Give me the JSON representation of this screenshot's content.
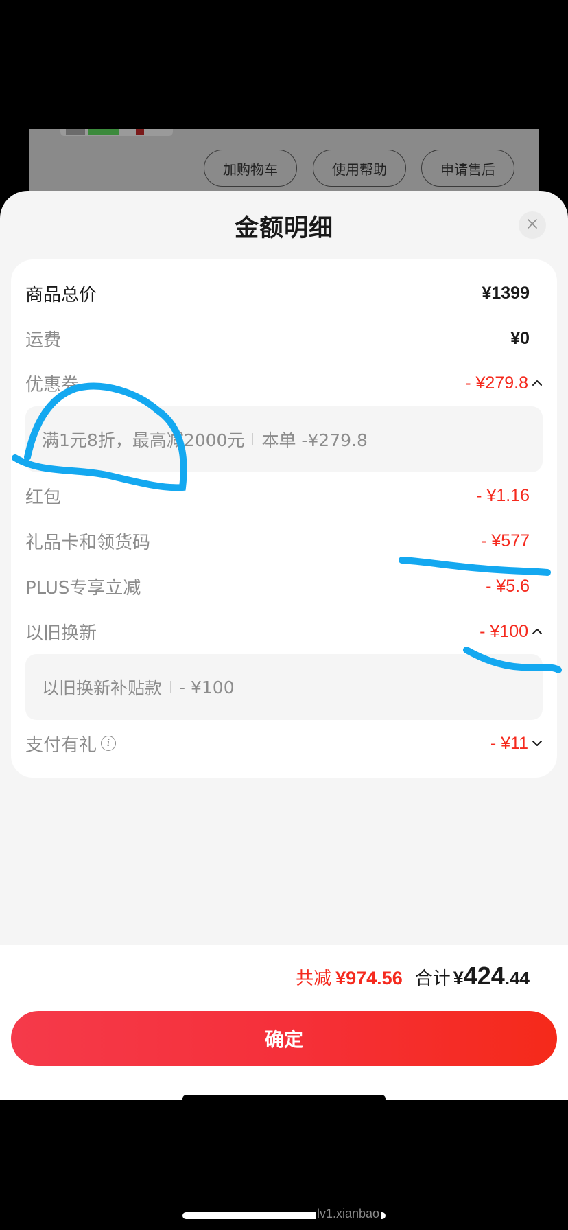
{
  "background_page": {
    "buttons": [
      "加购物车",
      "使用帮助",
      "申请售后"
    ]
  },
  "sheet": {
    "title": "金额明细",
    "close_icon": "close-icon"
  },
  "rows": [
    {
      "label": "商品总价",
      "value": "¥1399",
      "style": "strong"
    },
    {
      "label": "运费",
      "value": "¥0",
      "style": "normal"
    },
    {
      "label": "优惠券",
      "value": "- ¥279.8",
      "style": "discount",
      "expanded": true,
      "detail": {
        "text": "满1元8折，最高减2000元",
        "amount": "本单 -¥279.8"
      }
    },
    {
      "label": "红包",
      "value": "- ¥1.16",
      "style": "discount"
    },
    {
      "label": "礼品卡和领货码",
      "value": "- ¥577",
      "style": "discount"
    },
    {
      "label": "PLUS专享立减",
      "value": "- ¥5.6",
      "style": "discount"
    },
    {
      "label": "以旧换新",
      "value": "- ¥100",
      "style": "discount",
      "expanded": true,
      "detail": {
        "text": "以旧换新补贴款",
        "amount": "- ¥100"
      }
    },
    {
      "label": "支付有礼",
      "value": "- ¥11",
      "style": "discount",
      "expanded": false,
      "info_icon": "info-icon"
    }
  ],
  "footer": {
    "saved_label": "共减",
    "saved_amount": "¥974.56",
    "total_label": "合计",
    "total_currency": "¥",
    "total_integer": "424",
    "total_decimal": ".44",
    "confirm_label": "确定"
  },
  "watermark": "lv1.xianbao",
  "colors": {
    "accent_red": "#f52a1e",
    "annotation_blue": "#14a8f0",
    "sheet_bg": "#f5f5f5"
  }
}
